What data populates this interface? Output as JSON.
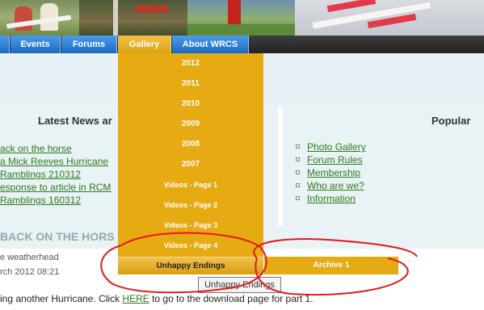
{
  "nav": {
    "tabs": [
      {
        "label": "Events"
      },
      {
        "label": "Forums"
      },
      {
        "label": "Gallery"
      },
      {
        "label": "About WRCS"
      }
    ]
  },
  "gallery_menu": {
    "items": [
      "2012",
      "2011",
      "2010",
      "2009",
      "2008",
      "2007",
      "Videos - Page 1",
      "Videos - Page 2",
      "Videos - Page 3",
      "Videos - Page 4",
      "Unhappy Endings"
    ],
    "submenu_item": "Archive 1",
    "tooltip": "Unhappy Endings"
  },
  "latest_news": {
    "title": "Latest News ar",
    "items": [
      "ack on the horse",
      "a Mick Reeves Hurricane",
      " Ramblings 210312",
      "esponse to article in RCM",
      " Ramblings 160312"
    ]
  },
  "popular": {
    "title": "Popular",
    "items": [
      "Photo Gallery",
      "Forum Rules",
      "Membership",
      "Who are we?",
      "Information"
    ]
  },
  "article": {
    "title": "BACK ON THE HORS",
    "byline": "e weatherhead",
    "date": "rch 2012 08:21",
    "body_before": "ing another Hurricane. Click ",
    "body_link": "HERE",
    "body_after": " to go to the download page for part 1."
  },
  "colors": {
    "nav_tab": "#2a7fd6",
    "nav_active": "#e6ab12",
    "dropdown": "#e6ab12",
    "link": "#2f7a1f",
    "annotation": "#e11919"
  }
}
